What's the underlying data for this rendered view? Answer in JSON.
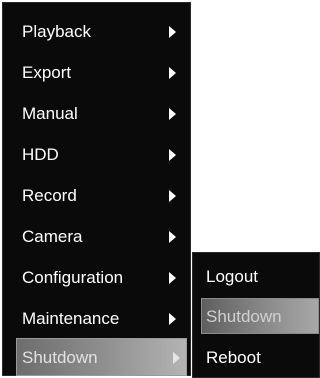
{
  "main_menu": {
    "items": [
      {
        "label": "Playback",
        "icon": "chevron-right-icon"
      },
      {
        "label": "Export",
        "icon": "chevron-right-icon"
      },
      {
        "label": "Manual",
        "icon": "chevron-right-icon"
      },
      {
        "label": "HDD",
        "icon": "chevron-right-icon"
      },
      {
        "label": "Record",
        "icon": "chevron-right-icon"
      },
      {
        "label": "Camera",
        "icon": "chevron-right-icon"
      },
      {
        "label": "Configuration",
        "icon": "chevron-right-icon"
      },
      {
        "label": "Maintenance",
        "icon": "chevron-right-icon"
      },
      {
        "label": "Shutdown",
        "icon": "chevron-right-icon",
        "selected": true
      }
    ]
  },
  "sub_menu": {
    "items": [
      {
        "label": "Logout"
      },
      {
        "label": "Shutdown",
        "selected": true
      },
      {
        "label": "Reboot"
      }
    ]
  },
  "colors": {
    "menu_background": "#0a0a0a",
    "text": "#ffffff",
    "highlight_start": "#6d6d6d",
    "highlight_end": "#b4b4b4"
  }
}
